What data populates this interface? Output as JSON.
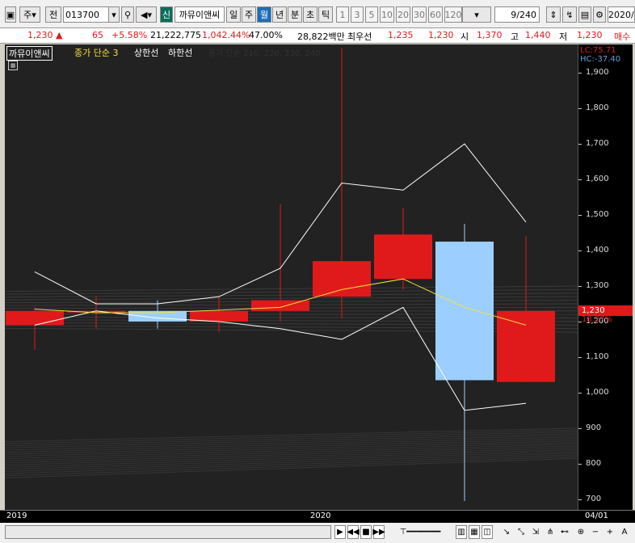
{
  "toolbar": {
    "market": "주",
    "previous": "전",
    "code": "013700",
    "new_badge": "신",
    "stock_name": "까뮤이앤씨",
    "periods": [
      "일",
      "주",
      "월",
      "년",
      "분",
      "초",
      "틱"
    ],
    "selected_period": "월",
    "intervals": [
      "1",
      "3",
      "5",
      "10",
      "20",
      "30",
      "60",
      "120"
    ],
    "count": "9/240",
    "date": "2020/"
  },
  "quote": {
    "price": "1,230",
    "change": "65",
    "change_pct": "+5.58%",
    "volume": "21,222,775",
    "volume_pct": "1,042.44%",
    "turnover_pct": "47.00%",
    "amount": "28,822백만",
    "best_bid_label": "최우선",
    "best_bid": "1,235",
    "best_ask": "1,230",
    "open_label": "시",
    "open": "1,370",
    "high_label": "고",
    "high": "1,440",
    "low_label": "저",
    "low": "1,230",
    "trade_label": "매수"
  },
  "legend": {
    "name": "까뮤이앤씨",
    "ma": "종가 단순 3",
    "upper": "상한선",
    "lower": "하한선",
    "overlay": "종가 단순 210, 220, 230, 240"
  },
  "axis": {
    "lc": "LC:75.71",
    "hc": "HC:-37.40",
    "current": "1,230",
    "current_pct": "18.27%"
  },
  "xaxis": {
    "labels": [
      "2019",
      "2020"
    ],
    "date": "04/01"
  },
  "colors": {
    "up": "#e01a1a",
    "down": "#9ccfff",
    "ma": "#f0e040",
    "envelope": "#ffffff"
  },
  "chart_data": {
    "type": "candlestick",
    "ylim": [
      670,
      1980
    ],
    "yticks": [
      700,
      800,
      900,
      1000,
      1100,
      1200,
      1300,
      1400,
      1500,
      1600,
      1700,
      1800,
      1900
    ],
    "candles": [
      {
        "o": 1190,
        "h": 1240,
        "l": 1120,
        "c": 1230
      },
      {
        "o": 1230,
        "h": 1270,
        "l": 1180,
        "c": 1230
      },
      {
        "o": 1230,
        "h": 1260,
        "l": 1180,
        "c": 1200
      },
      {
        "o": 1200,
        "h": 1270,
        "l": 1170,
        "c": 1230
      },
      {
        "o": 1230,
        "h": 1530,
        "l": 1200,
        "c": 1260
      },
      {
        "o": 1270,
        "h": 1970,
        "l": 1210,
        "c": 1370
      },
      {
        "o": 1320,
        "h": 1520,
        "l": 1290,
        "c": 1445
      },
      {
        "o": 1425,
        "h": 1475,
        "l": 695,
        "c": 1035
      },
      {
        "o": 1030,
        "h": 1440,
        "l": 1030,
        "c": 1230
      }
    ],
    "ma3": [
      1235,
      1225,
      1225,
      1232,
      1240,
      1290,
      1320,
      1240,
      1190
    ],
    "upper": [
      1340,
      1250,
      1250,
      1270,
      1350,
      1590,
      1570,
      1700,
      1480
    ],
    "lower": [
      1190,
      1230,
      1210,
      1200,
      1180,
      1150,
      1240,
      950,
      970
    ]
  }
}
